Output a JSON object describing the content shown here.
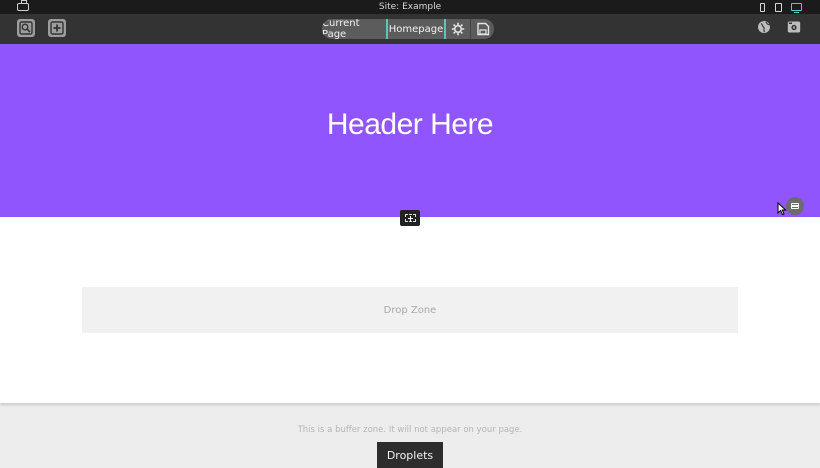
{
  "window": {
    "title": "Site: Example",
    "device_selected": "desktop"
  },
  "toolbar": {
    "left_tools": [
      "zoom-icon",
      "add-block-icon"
    ],
    "page_switcher": {
      "scope_label": "Current Page",
      "page_label": "Homepage",
      "actions": [
        "gear-icon",
        "save-icon"
      ]
    },
    "right_tools": [
      "globe-icon",
      "preview-icon"
    ]
  },
  "canvas": {
    "hero_title": "Header Here",
    "hero_color": "#9155fd",
    "drop_zone_label": "Drop Zone",
    "buffer_note": "This is a buffer zone. It will not appear on your page.",
    "droplets_label": "Droplets"
  },
  "colors": {
    "accent": "#5ac7b6",
    "toolbar": "#333333"
  }
}
